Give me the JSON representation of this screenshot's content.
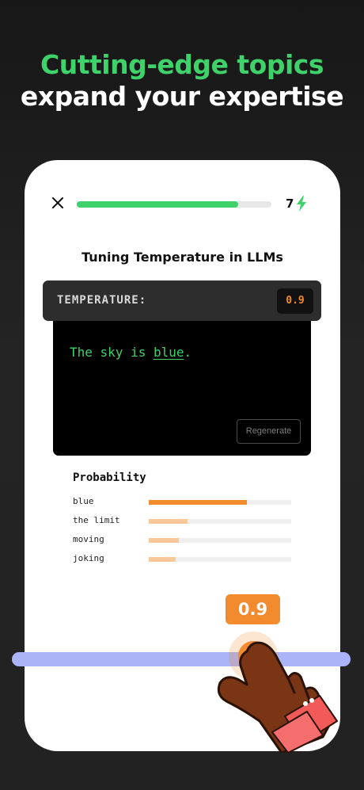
{
  "headline": {
    "line1": "Cutting-edge topics",
    "line2": "expand your expertise"
  },
  "lesson": {
    "progress": 0.83,
    "streak_count": "7",
    "title": "Tuning Temperature in LLMs"
  },
  "temperature": {
    "label": "TEMPERATURE:",
    "value": "0.9"
  },
  "terminal": {
    "sentence_prefix": "The sky is ",
    "word": "blue",
    "sentence_suffix": ".",
    "regenerate_label": "Regenerate"
  },
  "probability": {
    "title": "Probability",
    "rows": [
      {
        "label": "blue",
        "value": 0.69
      },
      {
        "label": "the limit",
        "value": 0.27
      },
      {
        "label": "moving",
        "value": 0.21
      },
      {
        "label": "joking",
        "value": 0.19
      }
    ]
  },
  "slider": {
    "value_label": "0.9",
    "value": 0.9
  },
  "colors": {
    "accent_green": "#3fd16a",
    "accent_orange": "#f28a2e",
    "light_orange": "#f9c89a",
    "slider_track": "#aab4f7"
  },
  "icons": {
    "close": "close-icon",
    "streak": "lightning-bolt-icon",
    "hand": "pointing-hand-icon"
  }
}
